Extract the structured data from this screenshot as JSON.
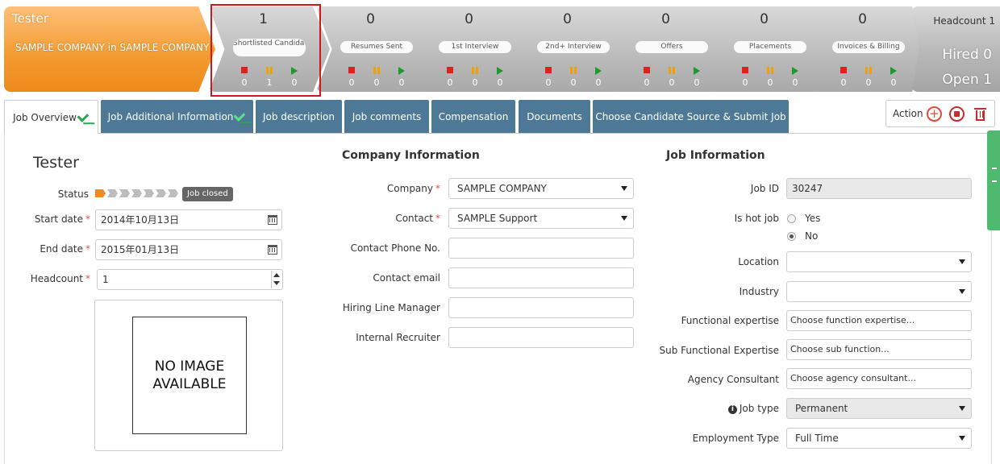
{
  "pipeline": {
    "job_title": "Tester",
    "company_line": "SAMPLE COMPANY in SAMPLE COMPANY",
    "stages": [
      {
        "label": "Shortlisted Candidates",
        "count": "1",
        "stopped": "0",
        "paused": "1",
        "active": "0"
      },
      {
        "label": "Resumes Sent",
        "count": "0",
        "stopped": "0",
        "paused": "0",
        "active": "0"
      },
      {
        "label": "1st Interview",
        "count": "0",
        "stopped": "0",
        "paused": "0",
        "active": "0"
      },
      {
        "label": "2nd+ Interview",
        "count": "0",
        "stopped": "0",
        "paused": "0",
        "active": "0"
      },
      {
        "label": "Offers",
        "count": "0",
        "stopped": "0",
        "paused": "0",
        "active": "0"
      },
      {
        "label": "Placements",
        "count": "0",
        "stopped": "0",
        "paused": "0",
        "active": "0"
      },
      {
        "label": "Invoices & Billing",
        "count": "0",
        "stopped": "0",
        "paused": "0",
        "active": "0"
      }
    ],
    "summary": {
      "headcount": "Headcount 1",
      "hired": "Hired 0",
      "open": "Open 1"
    }
  },
  "tabs": [
    {
      "label": "Job Overview",
      "checked": true
    },
    {
      "label": "Job Additional Information",
      "checked": true
    },
    {
      "label": "Job description"
    },
    {
      "label": "Job comments"
    },
    {
      "label": "Compensation"
    },
    {
      "label": "Documents"
    },
    {
      "label": "Choose Candidate Source & Submit Job"
    }
  ],
  "action": {
    "label": "Action"
  },
  "overview": {
    "title": "Tester",
    "status_label": "Status",
    "status_badge": "Job closed",
    "status_level": "1 of 8",
    "start_label": "Start date",
    "start_value": "2014年10月13日",
    "end_label": "End date",
    "end_value": "2015年01月13日",
    "headcount_label": "Headcount",
    "headcount_value": "1",
    "no_image_line1": "NO IMAGE",
    "no_image_line2": "AVAILABLE"
  },
  "company": {
    "title": "Company Information",
    "company_label": "Company",
    "company_value": "SAMPLE COMPANY",
    "contact_label": "Contact",
    "contact_value": "SAMPLE Support",
    "phone_label": "Contact Phone No.",
    "email_label": "Contact email",
    "manager_label": "Hiring Line Manager",
    "recruiter_label": "Internal Recruiter"
  },
  "job": {
    "title": "Job Information",
    "id_label": "Job ID",
    "id_value": "30247",
    "hot_label": "Is hot job",
    "hot_yes": "Yes",
    "hot_no": "No",
    "location_label": "Location",
    "industry_label": "Industry",
    "func_label": "Functional expertise",
    "func_placeholder": "Choose function expertise...",
    "subfunc_label": "Sub Functional Expertise",
    "subfunc_placeholder": "Choose sub function...",
    "agency_label": "Agency Consultant",
    "agency_placeholder": "Choose agency consultant...",
    "type_label": "Job type",
    "type_value": "Permanent",
    "emp_label": "Employment Type",
    "emp_value": "Full Time"
  }
}
